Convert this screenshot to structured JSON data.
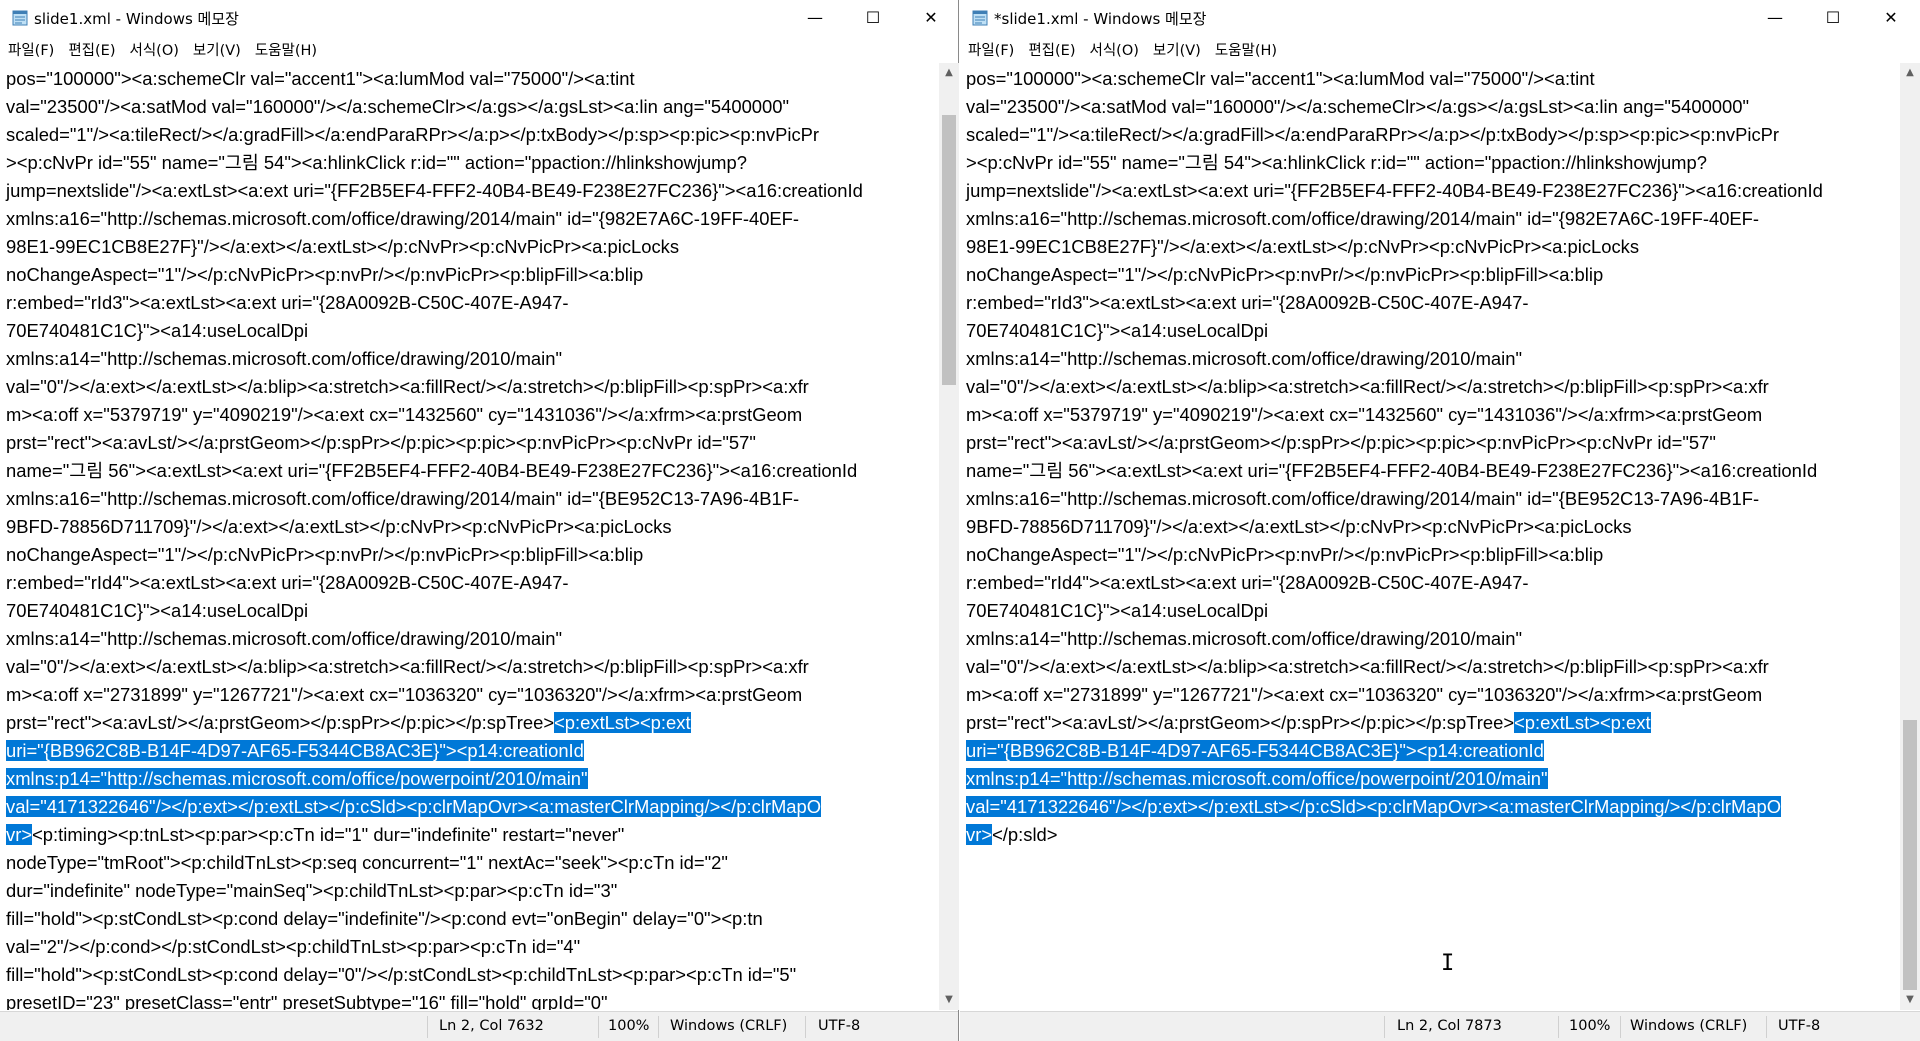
{
  "colors": {
    "selection": "#0078d7",
    "chrome": "#f0f0f0"
  },
  "windows": [
    {
      "title": "slide1.xml - Windows 메모장",
      "icon": "notepad-icon",
      "menu": [
        "파일(F)",
        "편집(E)",
        "서식(O)",
        "보기(V)",
        "도움말(H)"
      ],
      "lines_before": [
        "pos=\"100000\"><a:schemeClr val=\"accent1\"><a:lumMod val=\"75000\"/><a:tint",
        "val=\"23500\"/><a:satMod val=\"160000\"/></a:schemeClr></a:gs></a:gsLst><a:lin ang=\"5400000\"",
        "scaled=\"1\"/><a:tileRect/></a:gradFill></a:endParaRPr></a:p></p:txBody></p:sp><p:pic><p:nvPicPr",
        "><p:cNvPr id=\"55\" name=\"그림 54\"><a:hlinkClick r:id=\"\" action=\"ppaction://hlinkshowjump?",
        "jump=nextslide\"/><a:extLst><a:ext uri=\"{FF2B5EF4-FFF2-40B4-BE49-F238E27FC236}\"><a16:creationId",
        "xmlns:a16=\"http://schemas.microsoft.com/office/drawing/2014/main\" id=\"{982E7A6C-19FF-40EF-",
        "98E1-99EC1CB8E27F}\"/></a:ext></a:extLst></p:cNvPr><p:cNvPicPr><a:picLocks",
        "noChangeAspect=\"1\"/></p:cNvPicPr><p:nvPr/></p:nvPicPr><p:blipFill><a:blip",
        "r:embed=\"rId3\"><a:extLst><a:ext uri=\"{28A0092B-C50C-407E-A947-",
        "70E740481C1C}\"><a14:useLocalDpi",
        "xmlns:a14=\"http://schemas.microsoft.com/office/drawing/2010/main\"",
        "val=\"0\"/></a:ext></a:extLst></a:blip><a:stretch><a:fillRect/></a:stretch></p:blipFill><p:spPr><a:xfr",
        "m><a:off x=\"5379719\" y=\"4090219\"/><a:ext cx=\"1432560\" cy=\"1431036\"/></a:xfrm><a:prstGeom",
        "prst=\"rect\"><a:avLst/></a:prstGeom></p:spPr></p:pic><p:pic><p:nvPicPr><p:cNvPr id=\"57\"",
        "name=\"그림 56\"><a:extLst><a:ext uri=\"{FF2B5EF4-FFF2-40B4-BE49-F238E27FC236}\"><a16:creationId",
        "xmlns:a16=\"http://schemas.microsoft.com/office/drawing/2014/main\" id=\"{BE952C13-7A96-4B1F-",
        "9BFD-78856D711709}\"/></a:ext></a:extLst></p:cNvPr><p:cNvPicPr><a:picLocks",
        "noChangeAspect=\"1\"/></p:cNvPicPr><p:nvPr/></p:nvPicPr><p:blipFill><a:blip",
        "r:embed=\"rId4\"><a:extLst><a:ext uri=\"{28A0092B-C50C-407E-A947-",
        "70E740481C1C}\"><a14:useLocalDpi",
        "xmlns:a14=\"http://schemas.microsoft.com/office/drawing/2010/main\"",
        "val=\"0\"/></a:ext></a:extLst></a:blip><a:stretch><a:fillRect/></a:stretch></p:blipFill><p:spPr><a:xfr",
        "m><a:off x=\"2731899\" y=\"1267721\"/><a:ext cx=\"1036320\" cy=\"1036320\"/></a:xfrm><a:prstGeom"
      ],
      "sel_prefix": "prst=\"rect\"><a:avLst/></a:prstGeom></p:spPr></p:pic></p:spTree>",
      "sel_lines": [
        "<p:extLst><p:ext",
        "uri=\"{BB962C8B-B14F-4D97-AF65-F5344CB8AC3E}\"><p14:creationId",
        "xmlns:p14=\"http://schemas.microsoft.com/office/powerpoint/2010/main\"",
        "val=\"4171322646\"/></p:ext></p:extLst></p:cSld><p:clrMapOvr><a:masterClrMapping/></p:clrMapO",
        "vr>"
      ],
      "sel_suffix": "<p:timing><p:tnLst><p:par><p:cTn id=\"1\" dur=\"indefinite\" restart=\"never\"",
      "lines_after": [
        "nodeType=\"tmRoot\"><p:childTnLst><p:seq concurrent=\"1\" nextAc=\"seek\"><p:cTn id=\"2\"",
        "dur=\"indefinite\" nodeType=\"mainSeq\"><p:childTnLst><p:par><p:cTn id=\"3\"",
        "fill=\"hold\"><p:stCondLst><p:cond delay=\"indefinite\"/><p:cond evt=\"onBegin\" delay=\"0\"><p:tn",
        "val=\"2\"/></p:cond></p:stCondLst><p:childTnLst><p:par><p:cTn id=\"4\"",
        "fill=\"hold\"><p:stCondLst><p:cond delay=\"0\"/></p:stCondLst><p:childTnLst><p:par><p:cTn id=\"5\"",
        "presetID=\"23\" presetClass=\"entr\" presetSubtype=\"16\" fill=\"hold\" grpId=\"0\""
      ],
      "status": {
        "position": "Ln 2, Col 7632",
        "zoom": "100%",
        "line_ending": "Windows (CRLF)",
        "encoding": "UTF-8"
      },
      "scroll_fraction": 0.05
    },
    {
      "title": "*slide1.xml - Windows 메모장",
      "icon": "notepad-icon",
      "menu": [
        "파일(F)",
        "편집(E)",
        "서식(O)",
        "보기(V)",
        "도움말(H)"
      ],
      "lines_before": [
        "pos=\"100000\"><a:schemeClr val=\"accent1\"><a:lumMod val=\"75000\"/><a:tint",
        "val=\"23500\"/><a:satMod val=\"160000\"/></a:schemeClr></a:gs></a:gsLst><a:lin ang=\"5400000\"",
        "scaled=\"1\"/><a:tileRect/></a:gradFill></a:endParaRPr></a:p></p:txBody></p:sp><p:pic><p:nvPicPr",
        "><p:cNvPr id=\"55\" name=\"그림 54\"><a:hlinkClick r:id=\"\" action=\"ppaction://hlinkshowjump?",
        "jump=nextslide\"/><a:extLst><a:ext uri=\"{FF2B5EF4-FFF2-40B4-BE49-F238E27FC236}\"><a16:creationId",
        "xmlns:a16=\"http://schemas.microsoft.com/office/drawing/2014/main\" id=\"{982E7A6C-19FF-40EF-",
        "98E1-99EC1CB8E27F}\"/></a:ext></a:extLst></p:cNvPr><p:cNvPicPr><a:picLocks",
        "noChangeAspect=\"1\"/></p:cNvPicPr><p:nvPr/></p:nvPicPr><p:blipFill><a:blip",
        "r:embed=\"rId3\"><a:extLst><a:ext uri=\"{28A0092B-C50C-407E-A947-",
        "70E740481C1C}\"><a14:useLocalDpi",
        "xmlns:a14=\"http://schemas.microsoft.com/office/drawing/2010/main\"",
        "val=\"0\"/></a:ext></a:extLst></a:blip><a:stretch><a:fillRect/></a:stretch></p:blipFill><p:spPr><a:xfr",
        "m><a:off x=\"5379719\" y=\"4090219\"/><a:ext cx=\"1432560\" cy=\"1431036\"/></a:xfrm><a:prstGeom",
        "prst=\"rect\"><a:avLst/></a:prstGeom></p:spPr></p:pic><p:pic><p:nvPicPr><p:cNvPr id=\"57\"",
        "name=\"그림 56\"><a:extLst><a:ext uri=\"{FF2B5EF4-FFF2-40B4-BE49-F238E27FC236}\"><a16:creationId",
        "xmlns:a16=\"http://schemas.microsoft.com/office/drawing/2014/main\" id=\"{BE952C13-7A96-4B1F-",
        "9BFD-78856D711709}\"/></a:ext></a:extLst></p:cNvPr><p:cNvPicPr><a:picLocks",
        "noChangeAspect=\"1\"/></p:cNvPicPr><p:nvPr/></p:nvPicPr><p:blipFill><a:blip",
        "r:embed=\"rId4\"><a:extLst><a:ext uri=\"{28A0092B-C50C-407E-A947-",
        "70E740481C1C}\"><a14:useLocalDpi",
        "xmlns:a14=\"http://schemas.microsoft.com/office/drawing/2010/main\"",
        "val=\"0\"/></a:ext></a:extLst></a:blip><a:stretch><a:fillRect/></a:stretch></p:blipFill><p:spPr><a:xfr",
        "m><a:off x=\"2731899\" y=\"1267721\"/><a:ext cx=\"1036320\" cy=\"1036320\"/></a:xfrm><a:prstGeom"
      ],
      "sel_prefix": "prst=\"rect\"><a:avLst/></a:prstGeom></p:spPr></p:pic></p:spTree>",
      "sel_lines": [
        "<p:extLst><p:ext",
        "uri=\"{BB962C8B-B14F-4D97-AF65-F5344CB8AC3E}\"><p14:creationId",
        "xmlns:p14=\"http://schemas.microsoft.com/office/powerpoint/2010/main\"",
        "val=\"4171322646\"/></p:ext></p:extLst></p:cSld><p:clrMapOvr><a:masterClrMapping/></p:clrMapO",
        "vr>"
      ],
      "sel_suffix": "</p:sld>",
      "lines_after": [],
      "status": {
        "position": "Ln 2, Col 7873",
        "zoom": "100%",
        "line_ending": "Windows (CRLF)",
        "encoding": "UTF-8"
      },
      "scroll_fraction": 1.0
    }
  ]
}
